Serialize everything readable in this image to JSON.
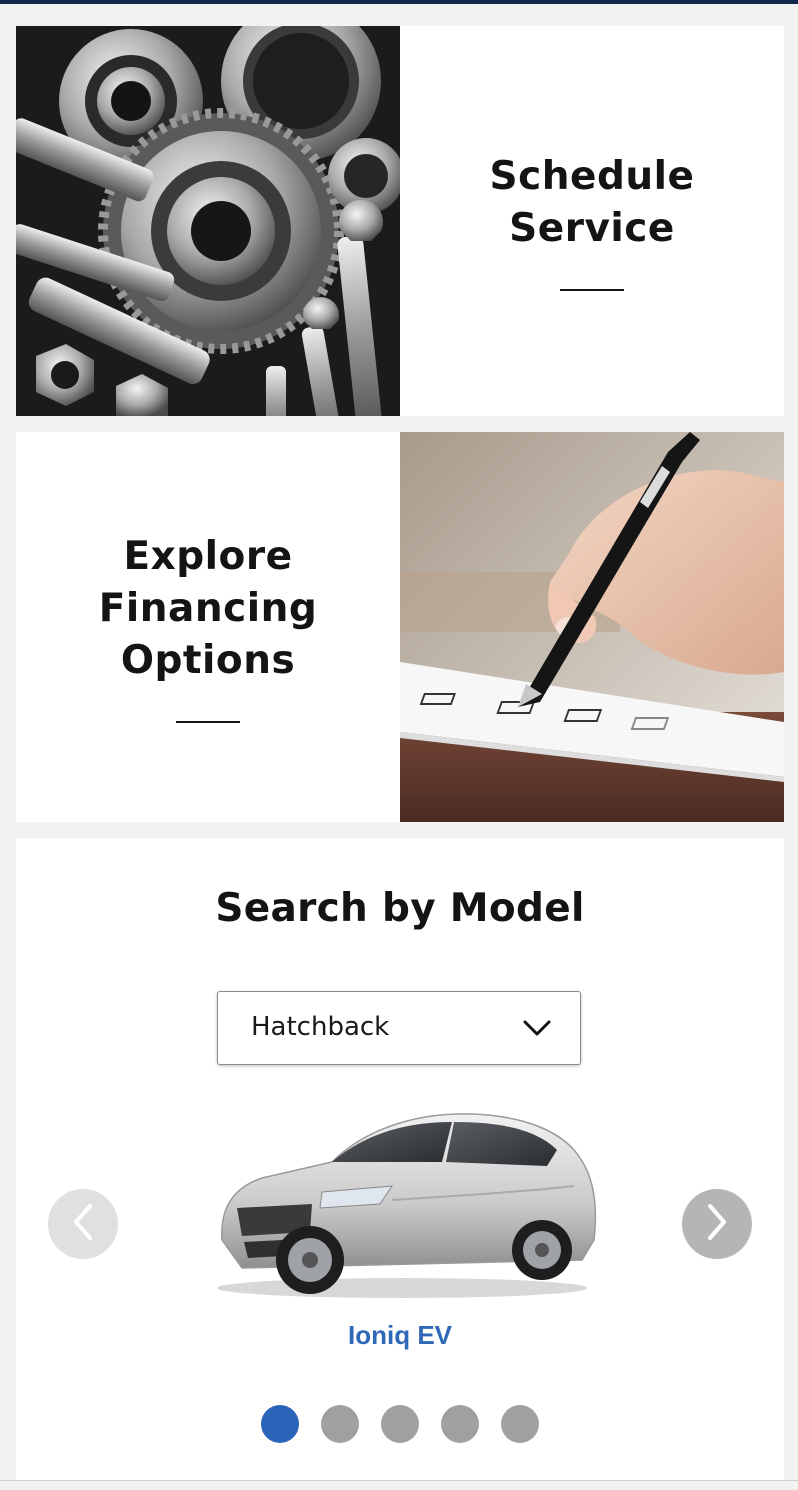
{
  "tiles": {
    "service": {
      "title": "Schedule\nService",
      "image_icon": "auto-parts-gears-wrenches-photo"
    },
    "financing": {
      "title": "Explore\nFinancing\nOptions",
      "image_icon": "hand-signing-document-photo"
    }
  },
  "search": {
    "title": "Search by Model",
    "selected_body_style": "Hatchback",
    "dropdown_icon": "chevron-down-icon",
    "carousel": {
      "prev_icon": "chevron-left-icon",
      "next_icon": "chevron-right-icon",
      "current_model": "Ioniq EV",
      "current_model_image": "silver-hatchback-car-photo",
      "slide_count": 5,
      "active_slide": 1
    }
  },
  "colors": {
    "header_bar": "#13274a",
    "accent_blue": "#2a63b8",
    "model_link": "#3068b8",
    "inactive_dot": "#a0a0a0"
  }
}
